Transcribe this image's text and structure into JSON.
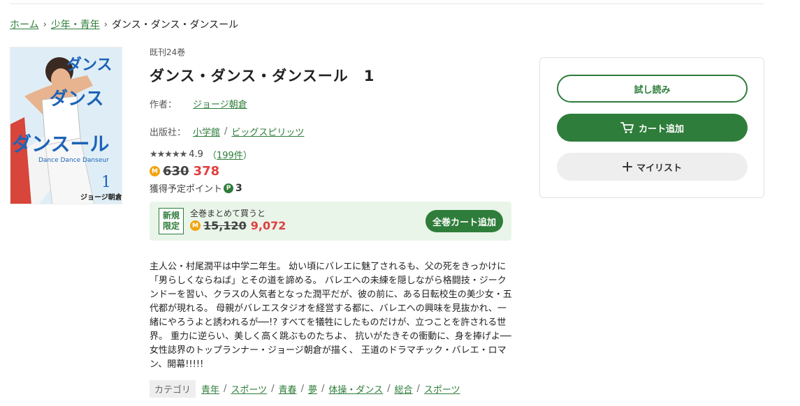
{
  "breadcrumb": {
    "home": "ホーム",
    "category": "少年・青年",
    "current": "ダンス・ダンス・ダンスール"
  },
  "book": {
    "volumes": "既刊24巻",
    "title": "ダンス・ダンス・ダンスール　1",
    "author_label": "作者：",
    "author": "ジョージ朝倉",
    "publisher_label": "出版社：",
    "publisher": "小学館",
    "label": "ビッグスピリッツ",
    "stars": "★★★★★",
    "rating": "4.9",
    "review_open": "（",
    "review_count": "199件",
    "review_close": "）",
    "coin_icon": "M",
    "old_price": "630",
    "new_price": "378",
    "points_label": "獲得予定ポイント",
    "points_icon": "P",
    "points": "3",
    "cover": {
      "title_line1": "ダンス",
      "title_line2": "ダンス",
      "title_line3": "ダンスール",
      "subtitle": "Dance Dance Danseur",
      "volume": "1",
      "author": "ジョージ朝倉"
    }
  },
  "bundle": {
    "badge_line1": "新規",
    "badge_line2": "限定",
    "text": "全巻まとめて買うと",
    "old_price": "15,120",
    "new_price": "9,072",
    "button": "全巻カート追加"
  },
  "description": "主人公・村尾潤平は中学二年生。 幼い頃にバレエに魅了されるも、父の死をきっかけに「男らしくならねば」とその道を諦める。 バレエへの未練を隠しながら格闘技・ジークンドーを習い、クラスの人気者となった潤平だが、彼の前に、ある日転校生の美少女・五代都が現れる。 母親がバレエスタジオを経営する都に、バレエへの興味を見抜かれ、一緒にやろうよと誘われるが──!? すべてを犠牲にしたものだけが、立つことを許される世界。 重力に逆らい、美しく高く跳ぶものたちよ、 抗いがたきその衝動に、身を捧げよ── 女性誌界のトップランナー・ジョージ朝倉が描く、 王道のドラマチック・バレエ・ロマン、開幕!!!!!",
  "categories": {
    "label": "カテゴリ",
    "items": [
      "青年",
      "スポーツ",
      "青春",
      "夢",
      "体操・ダンス",
      "総合",
      "スポーツ"
    ]
  },
  "actions": {
    "trial": "試し読み",
    "cart": "カート追加",
    "mylist": "マイリスト"
  },
  "colors": {
    "accent": "#2e7d3a",
    "sale": "#e04040",
    "coin": "#f2a30f"
  }
}
